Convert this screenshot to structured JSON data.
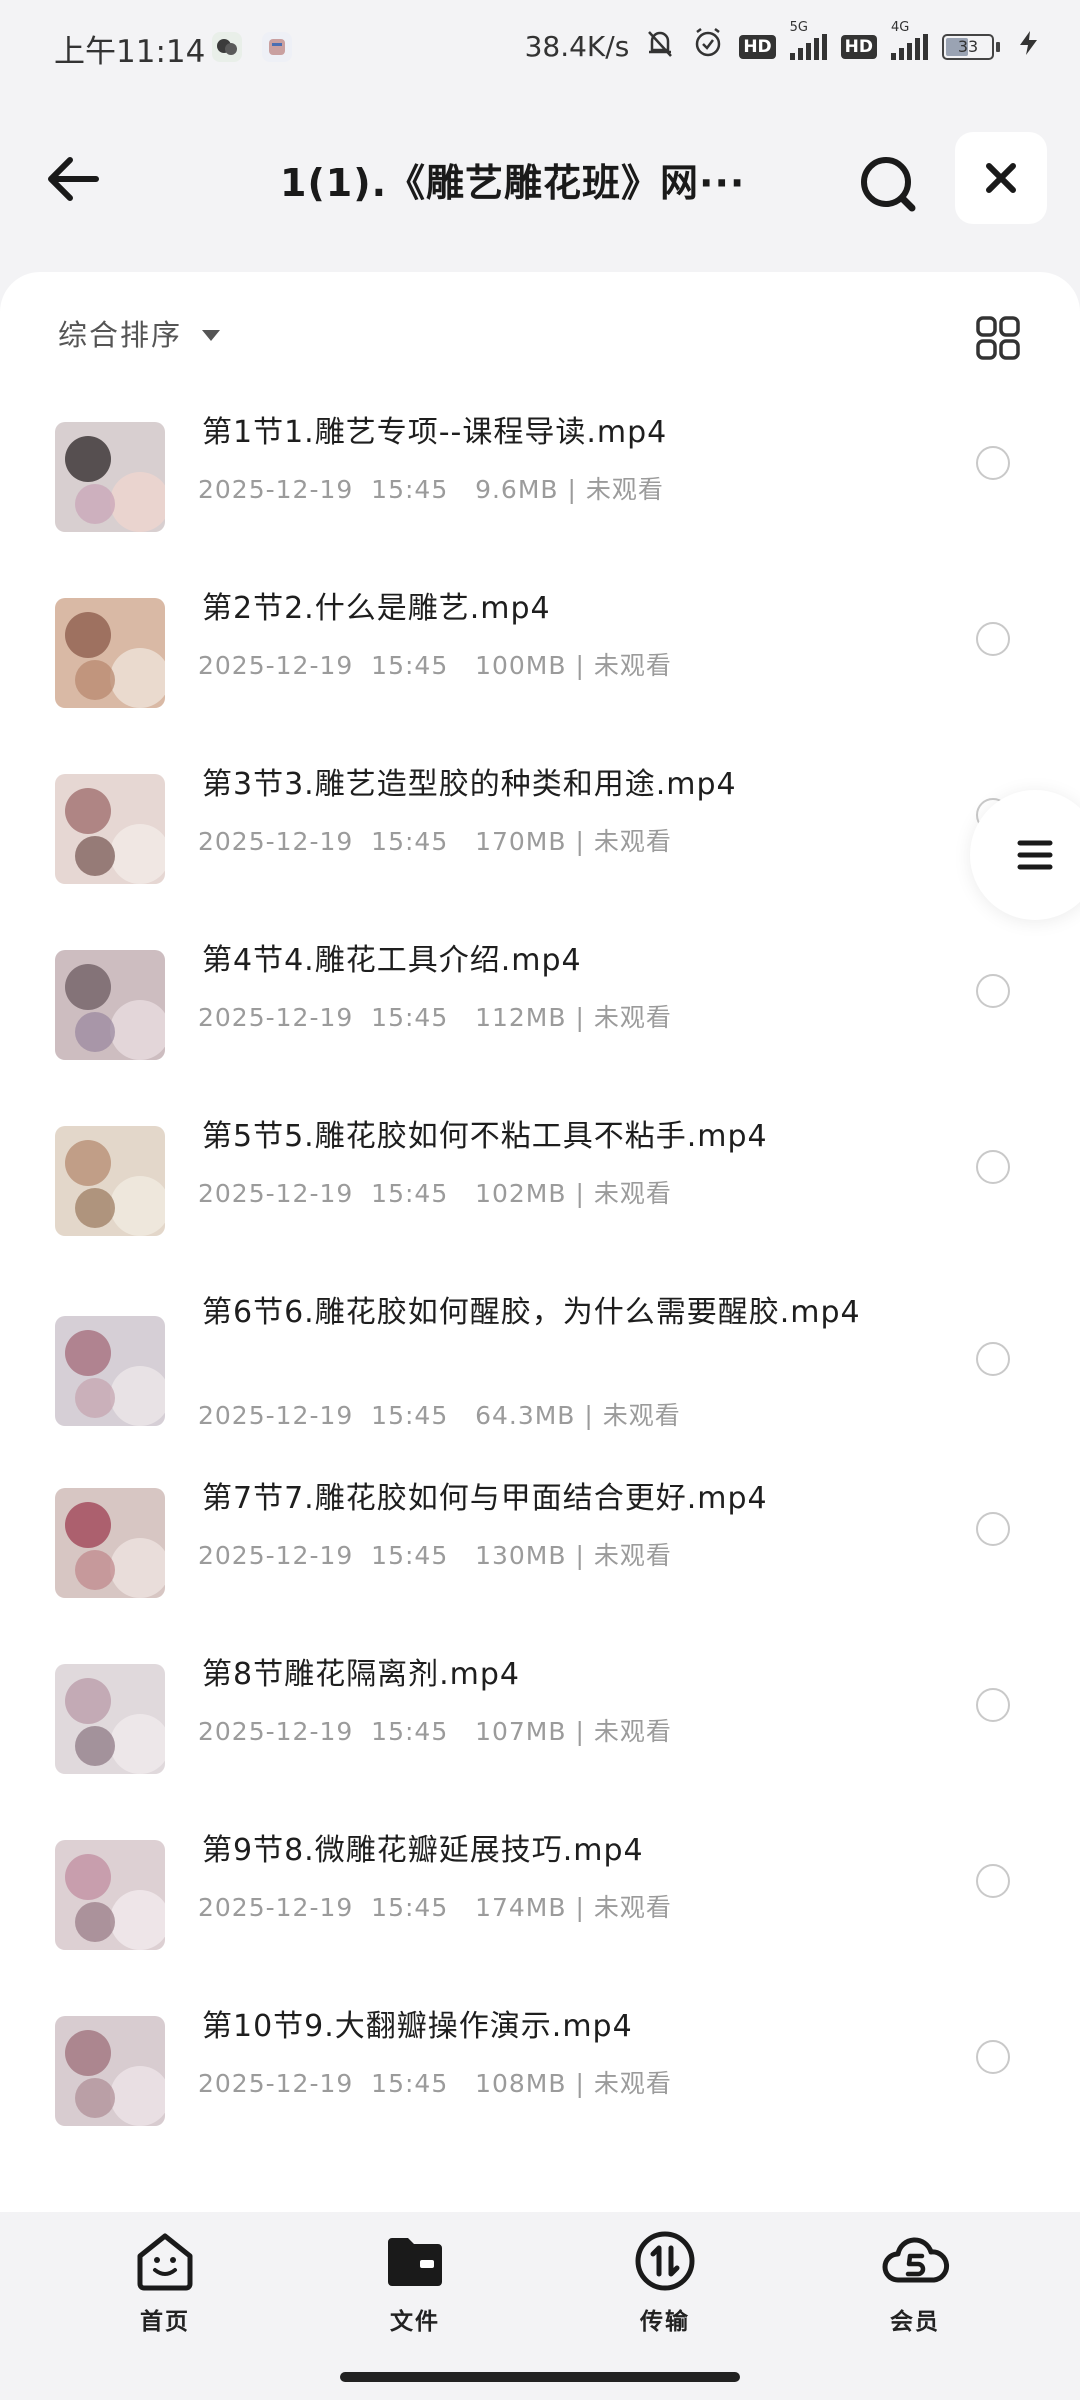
{
  "status_bar": {
    "time": "上午11:14",
    "net_speed": "38.4K/s",
    "hd_label": "HD",
    "net_5g": "5G",
    "net_4g": "4G",
    "battery": "33",
    "icons": [
      "wechat-icon",
      "app-icon",
      "mute-icon",
      "alarm-icon",
      "signal-icon",
      "battery-icon",
      "charging-icon"
    ]
  },
  "header": {
    "title": "1(1).《雕艺雕花班》网···",
    "back_icon": "arrow-left-icon",
    "search_icon": "search-icon",
    "close_icon": "close-icon"
  },
  "toolbar": {
    "sort_label": "综合排序",
    "view_icon": "grid-view-icon"
  },
  "files": [
    {
      "name": "第1节1.雕艺专项--课程导读.mp4",
      "date": "2025-12-19  15:45",
      "size": "9.6MB",
      "status": "未观看"
    },
    {
      "name": "第2节2.什么是雕艺.mp4",
      "date": "2025-12-19  15:45",
      "size": "100MB",
      "status": "未观看"
    },
    {
      "name": "第3节3.雕艺造型胶的种类和用途.mp4",
      "date": "2025-12-19  15:45",
      "size": "170MB",
      "status": "未观看"
    },
    {
      "name": "第4节4.雕花工具介绍.mp4",
      "date": "2025-12-19  15:45",
      "size": "112MB",
      "status": "未观看"
    },
    {
      "name": "第5节5.雕花胶如何不粘工具不粘手.mp4",
      "date": "2025-12-19  15:45",
      "size": "102MB",
      "status": "未观看"
    },
    {
      "name": "第6节6.雕花胶如何醒胶，为什么需要醒胶.mp4",
      "date": "2025-12-19  15:45",
      "size": "64.3MB",
      "status": "未观看"
    },
    {
      "name": "第7节7.雕花胶如何与甲面结合更好.mp4",
      "date": "2025-12-19  15:45",
      "size": "130MB",
      "status": "未观看"
    },
    {
      "name": "第8节雕花隔离剂.mp4",
      "date": "2025-12-19  15:45",
      "size": "107MB",
      "status": "未观看"
    },
    {
      "name": "第9节8.微雕花瓣延展技巧.mp4",
      "date": "2025-12-19  15:45",
      "size": "174MB",
      "status": "未观看"
    },
    {
      "name": "第10节9.大翻瓣操作演示.mp4",
      "date": "2025-12-19  15:45",
      "size": "108MB",
      "status": "未观看"
    }
  ],
  "bottom_nav": {
    "items": [
      {
        "label": "首页",
        "icon": "home-face-icon"
      },
      {
        "label": "文件",
        "icon": "folder-icon"
      },
      {
        "label": "传输",
        "icon": "transfer-icon"
      },
      {
        "label": "会员",
        "icon": "vip-cloud-icon"
      }
    ]
  }
}
